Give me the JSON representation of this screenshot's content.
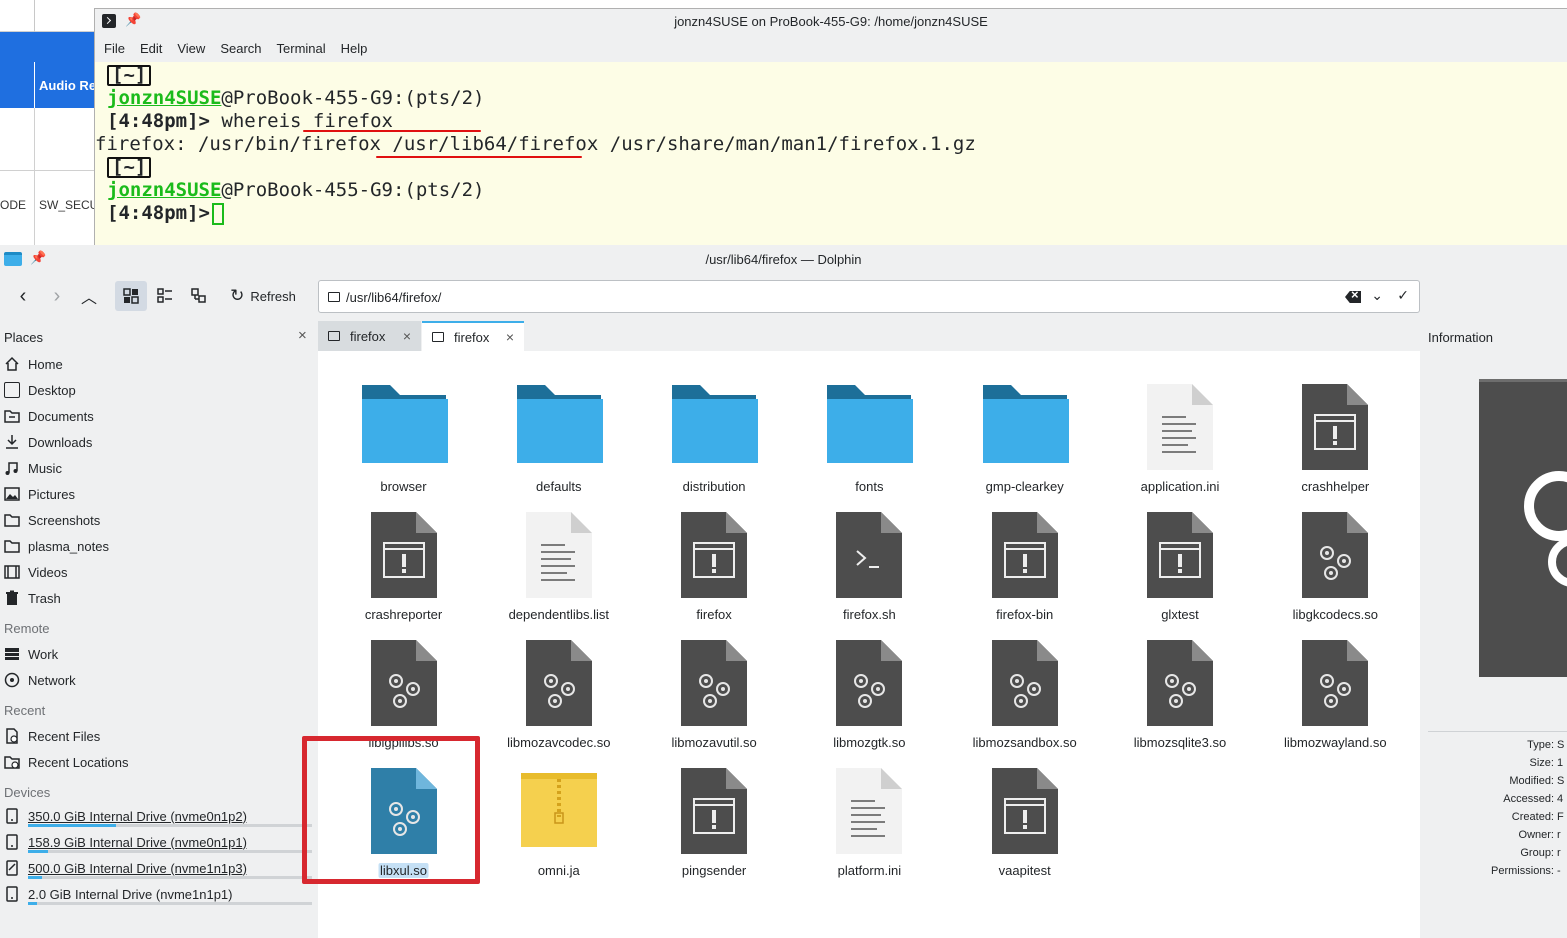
{
  "background_window": {
    "header_label": "Audio Re",
    "row_left": "ODE",
    "row_right": "SW_SECU"
  },
  "terminal": {
    "title": "jonzn4SUSE on ProBook-455-G9: /home/jonzn4SUSE",
    "menu": [
      "File",
      "Edit",
      "View",
      "Search",
      "Terminal",
      "Help"
    ],
    "dir_tag": "[~]",
    "user": "jonzn4SUSE",
    "host": "@ProBook-455-G9:(pts/2)",
    "prompt_time": "[4:48pm]>",
    "command": " whereis firefox",
    "output": "firefox: /usr/bin/firefox /usr/lib64/firefox /usr/share/man/man1/firefox.1.gz",
    "dir_tag2": "[~]",
    "user2": "jonzn4SUSE",
    "host2": "@ProBook-455-G9:(pts/2)",
    "prompt_time2": "[4:48pm]>"
  },
  "dolphin": {
    "title": "/usr/lib64/firefox — Dolphin",
    "toolbar": {
      "refresh_label": "Refresh"
    },
    "location": "/usr/lib64/firefox/",
    "places": {
      "title": "Places",
      "items": [
        "Home",
        "Desktop",
        "Documents",
        "Downloads",
        "Music",
        "Pictures",
        "Screenshots",
        "plasma_notes",
        "Videos",
        "Trash"
      ],
      "remote_title": "Remote",
      "remote_items": [
        "Work",
        "Network"
      ],
      "recent_title": "Recent",
      "recent_items": [
        "Recent Files",
        "Recent Locations"
      ],
      "devices_title": "Devices",
      "devices": [
        {
          "label": "350.0 GiB Internal Drive (nvme0n1p2)",
          "usage": 0.31
        },
        {
          "label": "158.9 GiB Internal Drive (nvme0n1p1)",
          "usage": 0.07
        },
        {
          "label": "500.0 GiB Internal Drive (nvme1n1p3)",
          "usage": 0.05
        },
        {
          "label": "2.0 GiB Internal Drive (nvme1n1p1)",
          "usage": 0.03
        }
      ]
    },
    "tabs": [
      {
        "label": "firefox",
        "active": false
      },
      {
        "label": "firefox",
        "active": true
      }
    ],
    "files": [
      {
        "name": "browser",
        "type": "folder"
      },
      {
        "name": "defaults",
        "type": "folder"
      },
      {
        "name": "distribution",
        "type": "folder"
      },
      {
        "name": "fonts",
        "type": "folder"
      },
      {
        "name": "gmp-clearkey",
        "type": "folder"
      },
      {
        "name": "application.ini",
        "type": "text"
      },
      {
        "name": "crashhelper",
        "type": "exec"
      },
      {
        "name": "crashreporter",
        "type": "exec"
      },
      {
        "name": "dependentlibs.list",
        "type": "text"
      },
      {
        "name": "firefox",
        "type": "exec"
      },
      {
        "name": "firefox.sh",
        "type": "script"
      },
      {
        "name": "firefox-bin",
        "type": "exec"
      },
      {
        "name": "glxtest",
        "type": "exec"
      },
      {
        "name": "libgkcodecs.so",
        "type": "lib"
      },
      {
        "name": "liblgpllibs.so",
        "type": "lib"
      },
      {
        "name": "libmozavcodec.so",
        "type": "lib"
      },
      {
        "name": "libmozavutil.so",
        "type": "lib"
      },
      {
        "name": "libmozgtk.so",
        "type": "lib"
      },
      {
        "name": "libmozsandbox.so",
        "type": "lib"
      },
      {
        "name": "libmozsqlite3.so",
        "type": "lib"
      },
      {
        "name": "libmozwayland.so",
        "type": "lib"
      },
      {
        "name": "libxul.so",
        "type": "lib-selected"
      },
      {
        "name": "omni.ja",
        "type": "archive"
      },
      {
        "name": "pingsender",
        "type": "exec"
      },
      {
        "name": "platform.ini",
        "type": "text"
      },
      {
        "name": "vaapitest",
        "type": "exec"
      }
    ],
    "info": {
      "title": "Information",
      "fields": [
        "Type:",
        "Size:",
        "Modified:",
        "Accessed:",
        "Created:",
        "Owner:",
        "Group:",
        "Permissions:"
      ],
      "values": [
        "S",
        "1",
        "S",
        "4",
        "F",
        "r",
        "r",
        "-"
      ]
    },
    "colors": {
      "accent": "#3daee9",
      "folder": "#3daee9",
      "highlight_box": "#d7282f",
      "terminal_user": "#1bbb1b",
      "annotation": "#e01010"
    }
  }
}
